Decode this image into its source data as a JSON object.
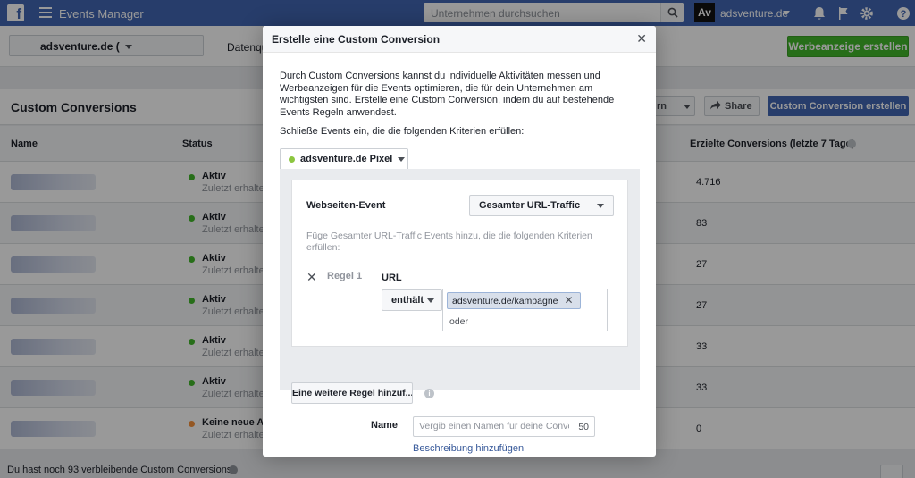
{
  "topbar": {
    "logo": "f",
    "app_title": "Events Manager",
    "search_placeholder": "Unternehmen durchsuchen",
    "account_logo": "Av",
    "account_name": "adsventure.de"
  },
  "subbar": {
    "account_select": "adsventure.de (",
    "tab_partial": "Datenqu",
    "create_ad_button": "Werbeanzeige erstellen"
  },
  "content": {
    "title": "Custom Conversions",
    "filter_button_partial": "rn",
    "share_button": "Share",
    "create_button": "Custom Conversion erstellen"
  },
  "table": {
    "headers": {
      "name": "Name",
      "status": "Status",
      "conversions": "Erzielte Conversions (letzte 7 Tage)"
    },
    "rows": [
      {
        "status": "Aktiv",
        "sub": "Zuletzt erhalten",
        "value": "4.716",
        "status_color": "#42b72a"
      },
      {
        "status": "Aktiv",
        "sub": "Zuletzt erhalten",
        "value": "83",
        "status_color": "#42b72a"
      },
      {
        "status": "Aktiv",
        "sub": "Zuletzt erhalten",
        "value": "27",
        "status_color": "#42b72a"
      },
      {
        "status": "Aktiv",
        "sub": "Zuletzt erhalten",
        "value": "27",
        "status_color": "#42b72a"
      },
      {
        "status": "Aktiv",
        "sub": "Zuletzt erhalten",
        "value": "33",
        "status_color": "#42b72a"
      },
      {
        "status": "Aktiv",
        "sub": "Zuletzt erhalten",
        "value": "33",
        "status_color": "#42b72a"
      },
      {
        "status": "Keine neue Ak",
        "sub": "Zuletzt erhalten",
        "value": "0",
        "status_color": "#f7923b"
      }
    ]
  },
  "footer": {
    "remaining_text": "Du hast noch 93 verbleibende Custom Conversions"
  },
  "modal": {
    "title": "Erstelle eine Custom Conversion",
    "intro": "Durch Custom Conversions kannst du individuelle Aktivitäten messen und Werbeanzeigen für die Events optimieren, die für dein Unternehmen am wichtigsten sind. Erstelle eine Custom Conversion, indem du auf bestehende Events Regeln anwendest.",
    "include_text": "Schließe Events ein, die die folgenden Kriterien erfüllen:",
    "pixel_name": "adsventure.de Pixel",
    "event_label": "Webseiten-Event",
    "event_value": "Gesamter URL-Traffic",
    "hint": "Füge Gesamter URL-Traffic Events hinzu, die die folgenden Kriterien erfüllen:",
    "rule_label": "Regel 1",
    "url_label": "URL",
    "operator": "enthält",
    "url_token": "adsventure.de/kampagne",
    "or_text": "oder",
    "add_rule_button": "Eine weitere Regel hinzuf...",
    "name_label": "Name",
    "name_placeholder": "Vergib einen Namen für deine Conversion",
    "name_counter": "50",
    "add_description_link": "Beschreibung hinzufügen"
  },
  "colors": {
    "brand_blue": "#4267b2",
    "create_green": "#42b72a",
    "active_status": "#42b72a",
    "inactive_status": "#f7923b"
  }
}
